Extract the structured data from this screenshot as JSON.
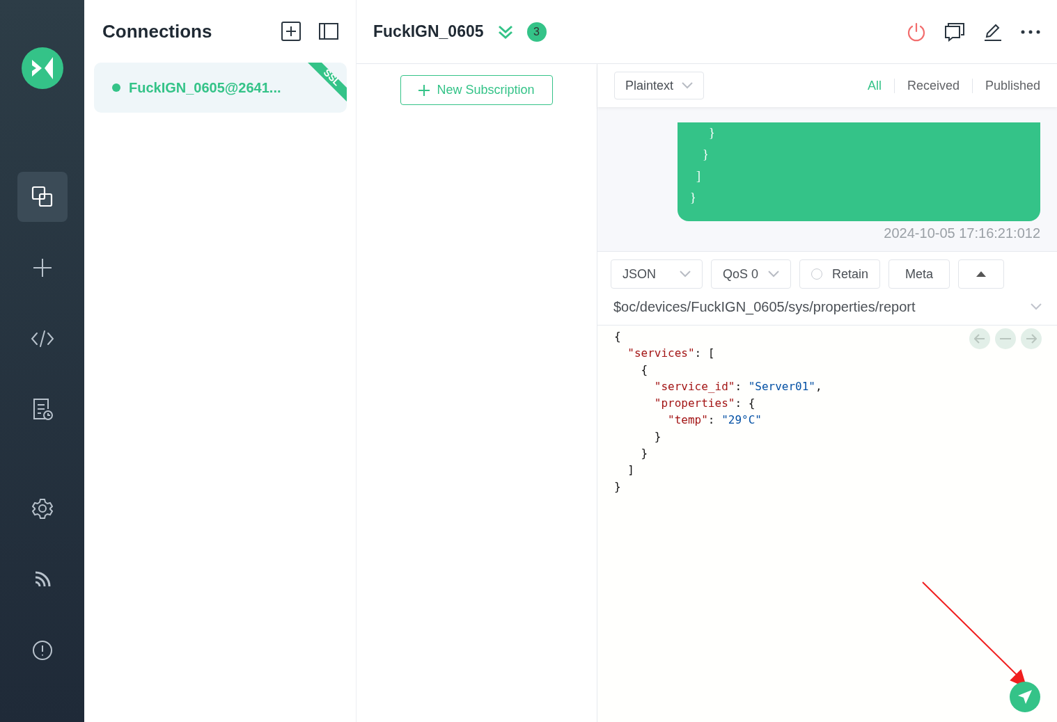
{
  "sidebar": {
    "items": [
      {
        "kind": "connections",
        "selected": true
      },
      {
        "kind": "new",
        "selected": false
      },
      {
        "kind": "script",
        "selected": false
      },
      {
        "kind": "log",
        "selected": false
      },
      {
        "kind": "settings",
        "selected": false
      },
      {
        "kind": "feed",
        "selected": false
      },
      {
        "kind": "about",
        "selected": false
      }
    ]
  },
  "connections": {
    "title": "Connections",
    "items": [
      {
        "name": "FuckIGN_0605@2641...",
        "connected": true,
        "selected": true,
        "ssl": "SSL"
      }
    ]
  },
  "header": {
    "title": "FuckIGN_0605",
    "badge": "3"
  },
  "subscriptions": {
    "new_button": "New Subscription"
  },
  "messages": {
    "format": "Plaintext",
    "filters": [
      {
        "label": "All",
        "selected": true
      },
      {
        "label": "Received",
        "selected": false
      },
      {
        "label": "Published",
        "selected": false
      }
    ],
    "items": [
      {
        "kind": "published",
        "lines": [
          "      }",
          "    }",
          "  ]",
          "}"
        ],
        "time": "2024-10-05 17:16:21:012"
      }
    ]
  },
  "publish": {
    "format": "JSON",
    "qos": "QoS 0",
    "retain": {
      "label": "Retain",
      "checked": false
    },
    "meta": "Meta",
    "topic": "$oc/devices/FuckIGN_0605/sys/properties/report",
    "code": [
      [
        {
          "kind": "punct",
          "text": "{"
        }
      ],
      [
        {
          "kind": "key",
          "text": "  \"services\""
        },
        {
          "kind": "punct",
          "text": ": ["
        }
      ],
      [
        {
          "kind": "punct",
          "text": "    {"
        }
      ],
      [
        {
          "kind": "key",
          "text": "      \"service_id\""
        },
        {
          "kind": "punct",
          "text": ": "
        },
        {
          "kind": "string",
          "text": "\"Server01\""
        },
        {
          "kind": "punct",
          "text": ","
        }
      ],
      [
        {
          "kind": "key",
          "text": "      \"properties\""
        },
        {
          "kind": "punct",
          "text": ": {"
        }
      ],
      [
        {
          "kind": "key",
          "text": "        \"temp\""
        },
        {
          "kind": "punct",
          "text": ": "
        },
        {
          "kind": "string",
          "text": "\"29°C\""
        }
      ],
      [
        {
          "kind": "punct",
          "text": "      }"
        }
      ],
      [
        {
          "kind": "punct",
          "text": "    }"
        }
      ],
      [
        {
          "kind": "punct",
          "text": "  ]"
        }
      ],
      [
        {
          "kind": "punct",
          "text": "}"
        }
      ]
    ]
  }
}
